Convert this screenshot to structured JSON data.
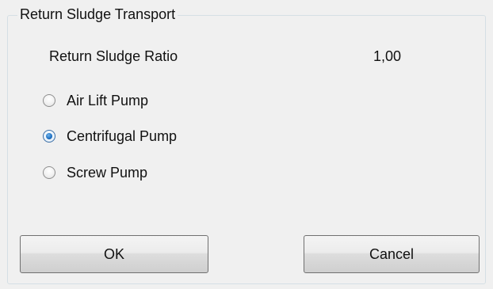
{
  "group": {
    "title": "Return Sludge Transport"
  },
  "ratio": {
    "label": "Return Sludge Ratio",
    "value": "1,00"
  },
  "pump_options": [
    {
      "label": "Air Lift Pump",
      "selected": false
    },
    {
      "label": "Centrifugal Pump",
      "selected": true
    },
    {
      "label": "Screw Pump",
      "selected": false
    }
  ],
  "buttons": {
    "ok_label": "OK",
    "cancel_label": "Cancel"
  },
  "colors": {
    "window_background": "#f0f0f0",
    "groupbox_border": "#d5dfe5",
    "radio_selected": "#1d6fc2",
    "button_border": "#707070"
  },
  "icons": {
    "radio_unchecked": "radio-unchecked-icon",
    "radio_checked": "radio-checked-icon"
  }
}
